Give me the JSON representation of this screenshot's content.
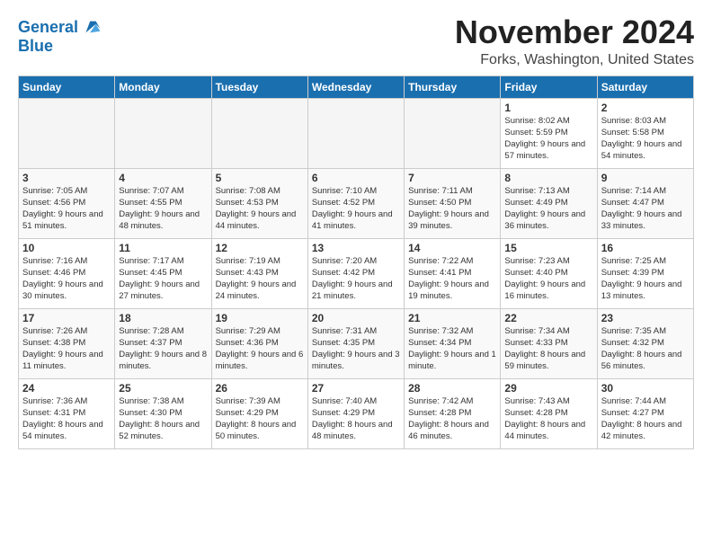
{
  "logo": {
    "line1": "General",
    "line2": "Blue"
  },
  "title": "November 2024",
  "location": "Forks, Washington, United States",
  "days_of_week": [
    "Sunday",
    "Monday",
    "Tuesday",
    "Wednesday",
    "Thursday",
    "Friday",
    "Saturday"
  ],
  "weeks": [
    [
      {
        "day": "",
        "detail": ""
      },
      {
        "day": "",
        "detail": ""
      },
      {
        "day": "",
        "detail": ""
      },
      {
        "day": "",
        "detail": ""
      },
      {
        "day": "",
        "detail": ""
      },
      {
        "day": "1",
        "detail": "Sunrise: 8:02 AM\nSunset: 5:59 PM\nDaylight: 9 hours and 57 minutes."
      },
      {
        "day": "2",
        "detail": "Sunrise: 8:03 AM\nSunset: 5:58 PM\nDaylight: 9 hours and 54 minutes."
      }
    ],
    [
      {
        "day": "3",
        "detail": "Sunrise: 7:05 AM\nSunset: 4:56 PM\nDaylight: 9 hours and 51 minutes."
      },
      {
        "day": "4",
        "detail": "Sunrise: 7:07 AM\nSunset: 4:55 PM\nDaylight: 9 hours and 48 minutes."
      },
      {
        "day": "5",
        "detail": "Sunrise: 7:08 AM\nSunset: 4:53 PM\nDaylight: 9 hours and 44 minutes."
      },
      {
        "day": "6",
        "detail": "Sunrise: 7:10 AM\nSunset: 4:52 PM\nDaylight: 9 hours and 41 minutes."
      },
      {
        "day": "7",
        "detail": "Sunrise: 7:11 AM\nSunset: 4:50 PM\nDaylight: 9 hours and 39 minutes."
      },
      {
        "day": "8",
        "detail": "Sunrise: 7:13 AM\nSunset: 4:49 PM\nDaylight: 9 hours and 36 minutes."
      },
      {
        "day": "9",
        "detail": "Sunrise: 7:14 AM\nSunset: 4:47 PM\nDaylight: 9 hours and 33 minutes."
      }
    ],
    [
      {
        "day": "10",
        "detail": "Sunrise: 7:16 AM\nSunset: 4:46 PM\nDaylight: 9 hours and 30 minutes."
      },
      {
        "day": "11",
        "detail": "Sunrise: 7:17 AM\nSunset: 4:45 PM\nDaylight: 9 hours and 27 minutes."
      },
      {
        "day": "12",
        "detail": "Sunrise: 7:19 AM\nSunset: 4:43 PM\nDaylight: 9 hours and 24 minutes."
      },
      {
        "day": "13",
        "detail": "Sunrise: 7:20 AM\nSunset: 4:42 PM\nDaylight: 9 hours and 21 minutes."
      },
      {
        "day": "14",
        "detail": "Sunrise: 7:22 AM\nSunset: 4:41 PM\nDaylight: 9 hours and 19 minutes."
      },
      {
        "day": "15",
        "detail": "Sunrise: 7:23 AM\nSunset: 4:40 PM\nDaylight: 9 hours and 16 minutes."
      },
      {
        "day": "16",
        "detail": "Sunrise: 7:25 AM\nSunset: 4:39 PM\nDaylight: 9 hours and 13 minutes."
      }
    ],
    [
      {
        "day": "17",
        "detail": "Sunrise: 7:26 AM\nSunset: 4:38 PM\nDaylight: 9 hours and 11 minutes."
      },
      {
        "day": "18",
        "detail": "Sunrise: 7:28 AM\nSunset: 4:37 PM\nDaylight: 9 hours and 8 minutes."
      },
      {
        "day": "19",
        "detail": "Sunrise: 7:29 AM\nSunset: 4:36 PM\nDaylight: 9 hours and 6 minutes."
      },
      {
        "day": "20",
        "detail": "Sunrise: 7:31 AM\nSunset: 4:35 PM\nDaylight: 9 hours and 3 minutes."
      },
      {
        "day": "21",
        "detail": "Sunrise: 7:32 AM\nSunset: 4:34 PM\nDaylight: 9 hours and 1 minute."
      },
      {
        "day": "22",
        "detail": "Sunrise: 7:34 AM\nSunset: 4:33 PM\nDaylight: 8 hours and 59 minutes."
      },
      {
        "day": "23",
        "detail": "Sunrise: 7:35 AM\nSunset: 4:32 PM\nDaylight: 8 hours and 56 minutes."
      }
    ],
    [
      {
        "day": "24",
        "detail": "Sunrise: 7:36 AM\nSunset: 4:31 PM\nDaylight: 8 hours and 54 minutes."
      },
      {
        "day": "25",
        "detail": "Sunrise: 7:38 AM\nSunset: 4:30 PM\nDaylight: 8 hours and 52 minutes."
      },
      {
        "day": "26",
        "detail": "Sunrise: 7:39 AM\nSunset: 4:29 PM\nDaylight: 8 hours and 50 minutes."
      },
      {
        "day": "27",
        "detail": "Sunrise: 7:40 AM\nSunset: 4:29 PM\nDaylight: 8 hours and 48 minutes."
      },
      {
        "day": "28",
        "detail": "Sunrise: 7:42 AM\nSunset: 4:28 PM\nDaylight: 8 hours and 46 minutes."
      },
      {
        "day": "29",
        "detail": "Sunrise: 7:43 AM\nSunset: 4:28 PM\nDaylight: 8 hours and 44 minutes."
      },
      {
        "day": "30",
        "detail": "Sunrise: 7:44 AM\nSunset: 4:27 PM\nDaylight: 8 hours and 42 minutes."
      }
    ]
  ]
}
